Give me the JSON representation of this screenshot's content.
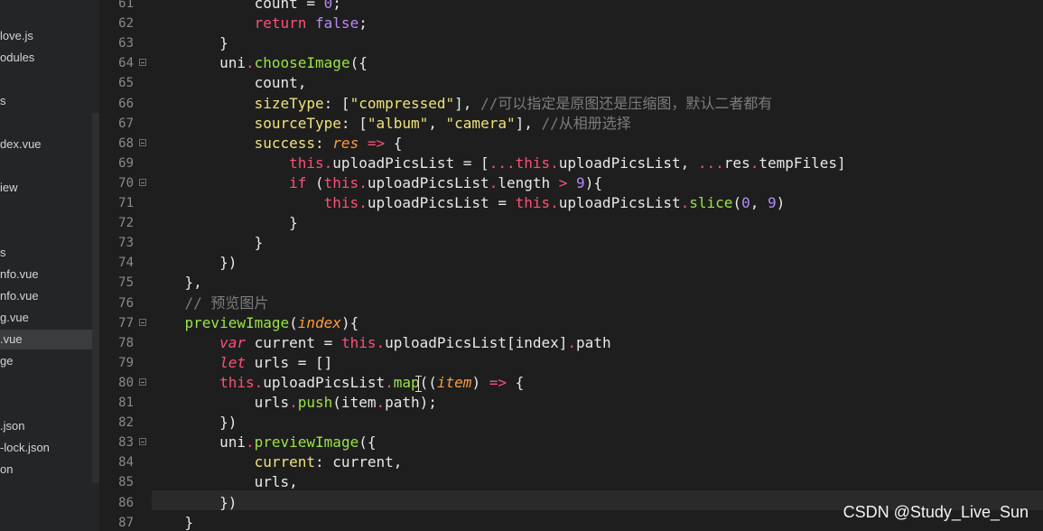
{
  "sidebar": {
    "files": [
      {
        "label": "love.js",
        "active": false
      },
      {
        "label": "odules",
        "active": false
      },
      {
        "label": "s",
        "active": false
      },
      {
        "label": "dex.vue",
        "active": false
      },
      {
        "label": "iew",
        "active": false
      },
      {
        "label": "s",
        "active": false
      },
      {
        "label": "nfo.vue",
        "active": false
      },
      {
        "label": "nfo.vue",
        "active": false
      },
      {
        "label": "g.vue",
        "active": false
      },
      {
        "label": ".vue",
        "active": true
      },
      {
        "label": "ge",
        "active": false
      },
      {
        "label": ".json",
        "active": false
      },
      {
        "label": "-lock.json",
        "active": false
      },
      {
        "label": "on",
        "active": false
      }
    ]
  },
  "editor": {
    "lines": [
      {
        "n": "61",
        "fold": false,
        "indent": "            ",
        "tokens": [
          {
            "t": "count = ",
            "c": "default"
          },
          {
            "t": "0",
            "c": "number"
          },
          {
            "t": ";",
            "c": "default"
          }
        ]
      },
      {
        "n": "62",
        "fold": false,
        "indent": "            ",
        "tokens": [
          {
            "t": "return ",
            "c": "keyword"
          },
          {
            "t": "false",
            "c": "number"
          },
          {
            "t": ";",
            "c": "default"
          }
        ]
      },
      {
        "n": "63",
        "fold": false,
        "indent": "        ",
        "tokens": [
          {
            "t": "}",
            "c": "default"
          }
        ]
      },
      {
        "n": "64",
        "fold": true,
        "indent": "        ",
        "tokens": [
          {
            "t": "uni",
            "c": "default"
          },
          {
            "t": ".",
            "c": "dot"
          },
          {
            "t": "chooseImage",
            "c": "method"
          },
          {
            "t": "({",
            "c": "default"
          }
        ]
      },
      {
        "n": "65",
        "fold": false,
        "indent": "            ",
        "tokens": [
          {
            "t": "count,",
            "c": "default"
          }
        ]
      },
      {
        "n": "66",
        "fold": false,
        "indent": "            ",
        "tokens": [
          {
            "t": "sizeType",
            "c": "string"
          },
          {
            "t": ": [",
            "c": "default"
          },
          {
            "t": "\"compressed\"",
            "c": "string"
          },
          {
            "t": "], ",
            "c": "default"
          },
          {
            "t": "//可以指定是原图还是压缩图，默认二者都有",
            "c": "comment"
          }
        ]
      },
      {
        "n": "67",
        "fold": false,
        "indent": "            ",
        "tokens": [
          {
            "t": "sourceType",
            "c": "string"
          },
          {
            "t": ": [",
            "c": "default"
          },
          {
            "t": "\"album\"",
            "c": "string"
          },
          {
            "t": ", ",
            "c": "default"
          },
          {
            "t": "\"camera\"",
            "c": "string"
          },
          {
            "t": "], ",
            "c": "default"
          },
          {
            "t": "//从相册选择",
            "c": "comment"
          }
        ]
      },
      {
        "n": "68",
        "fold": true,
        "indent": "            ",
        "tokens": [
          {
            "t": "success",
            "c": "string"
          },
          {
            "t": ": ",
            "c": "default"
          },
          {
            "t": "res",
            "c": "param"
          },
          {
            "t": " => ",
            "c": "keyword"
          },
          {
            "t": "{",
            "c": "default"
          }
        ]
      },
      {
        "n": "69",
        "fold": false,
        "indent": "                ",
        "tokens": [
          {
            "t": "this",
            "c": "keyword"
          },
          {
            "t": ".",
            "c": "dot"
          },
          {
            "t": "uploadPicsList = [",
            "c": "default"
          },
          {
            "t": "...",
            "c": "keyword"
          },
          {
            "t": "this",
            "c": "keyword"
          },
          {
            "t": ".",
            "c": "dot"
          },
          {
            "t": "uploadPicsList, ",
            "c": "default"
          },
          {
            "t": "...",
            "c": "keyword"
          },
          {
            "t": "res",
            "c": "default"
          },
          {
            "t": ".",
            "c": "dot"
          },
          {
            "t": "tempFiles]",
            "c": "default"
          }
        ]
      },
      {
        "n": "70",
        "fold": true,
        "indent": "                ",
        "tokens": [
          {
            "t": "if",
            "c": "keyword"
          },
          {
            "t": " (",
            "c": "default"
          },
          {
            "t": "this",
            "c": "keyword"
          },
          {
            "t": ".",
            "c": "dot"
          },
          {
            "t": "uploadPicsList",
            "c": "default"
          },
          {
            "t": ".",
            "c": "dot"
          },
          {
            "t": "length ",
            "c": "default"
          },
          {
            "t": ">",
            "c": "keyword"
          },
          {
            "t": " ",
            "c": "default"
          },
          {
            "t": "9",
            "c": "number"
          },
          {
            "t": "){",
            "c": "default"
          }
        ]
      },
      {
        "n": "71",
        "fold": false,
        "indent": "                    ",
        "tokens": [
          {
            "t": "this",
            "c": "keyword"
          },
          {
            "t": ".",
            "c": "dot"
          },
          {
            "t": "uploadPicsList = ",
            "c": "default"
          },
          {
            "t": "this",
            "c": "keyword"
          },
          {
            "t": ".",
            "c": "dot"
          },
          {
            "t": "uploadPicsList",
            "c": "default"
          },
          {
            "t": ".",
            "c": "dot"
          },
          {
            "t": "slice",
            "c": "method"
          },
          {
            "t": "(",
            "c": "default"
          },
          {
            "t": "0",
            "c": "number"
          },
          {
            "t": ", ",
            "c": "default"
          },
          {
            "t": "9",
            "c": "number"
          },
          {
            "t": ")",
            "c": "default"
          }
        ]
      },
      {
        "n": "72",
        "fold": false,
        "indent": "                ",
        "tokens": [
          {
            "t": "}",
            "c": "default"
          }
        ]
      },
      {
        "n": "73",
        "fold": false,
        "indent": "            ",
        "tokens": [
          {
            "t": "}",
            "c": "default"
          }
        ]
      },
      {
        "n": "74",
        "fold": false,
        "indent": "        ",
        "tokens": [
          {
            "t": "})",
            "c": "default"
          }
        ]
      },
      {
        "n": "75",
        "fold": false,
        "indent": "    ",
        "tokens": [
          {
            "t": "},",
            "c": "default"
          }
        ]
      },
      {
        "n": "76",
        "fold": false,
        "indent": "    ",
        "tokens": [
          {
            "t": "// 预览图片",
            "c": "comment"
          }
        ]
      },
      {
        "n": "77",
        "fold": true,
        "indent": "    ",
        "tokens": [
          {
            "t": "previewImage",
            "c": "method"
          },
          {
            "t": "(",
            "c": "default"
          },
          {
            "t": "index",
            "c": "param"
          },
          {
            "t": "){",
            "c": "default"
          }
        ]
      },
      {
        "n": "78",
        "fold": false,
        "indent": "        ",
        "tokens": [
          {
            "t": "var",
            "c": "var"
          },
          {
            "t": " current = ",
            "c": "default"
          },
          {
            "t": "this",
            "c": "keyword"
          },
          {
            "t": ".",
            "c": "dot"
          },
          {
            "t": "uploadPicsList[index]",
            "c": "default"
          },
          {
            "t": ".",
            "c": "dot"
          },
          {
            "t": "path",
            "c": "default"
          }
        ]
      },
      {
        "n": "79",
        "fold": false,
        "indent": "        ",
        "tokens": [
          {
            "t": "let",
            "c": "var"
          },
          {
            "t": " urls = []",
            "c": "default"
          }
        ]
      },
      {
        "n": "80",
        "fold": true,
        "indent": "        ",
        "tokens": [
          {
            "t": "this",
            "c": "keyword"
          },
          {
            "t": ".",
            "c": "dot"
          },
          {
            "t": "uploadPicsList",
            "c": "default"
          },
          {
            "t": ".",
            "c": "dot"
          },
          {
            "t": "map",
            "c": "method"
          },
          {
            "t": "((",
            "c": "default"
          },
          {
            "t": "item",
            "c": "param"
          },
          {
            "t": ") ",
            "c": "default"
          },
          {
            "t": "=>",
            "c": "keyword"
          },
          {
            "t": " {",
            "c": "default"
          }
        ]
      },
      {
        "n": "81",
        "fold": false,
        "indent": "            ",
        "tokens": [
          {
            "t": "urls",
            "c": "default"
          },
          {
            "t": ".",
            "c": "dot"
          },
          {
            "t": "push",
            "c": "method"
          },
          {
            "t": "(item",
            "c": "default"
          },
          {
            "t": ".",
            "c": "dot"
          },
          {
            "t": "path);",
            "c": "default"
          }
        ]
      },
      {
        "n": "82",
        "fold": false,
        "indent": "        ",
        "tokens": [
          {
            "t": "})",
            "c": "default"
          }
        ]
      },
      {
        "n": "83",
        "fold": true,
        "indent": "        ",
        "tokens": [
          {
            "t": "uni",
            "c": "default"
          },
          {
            "t": ".",
            "c": "dot"
          },
          {
            "t": "previewImage",
            "c": "method"
          },
          {
            "t": "({",
            "c": "default"
          }
        ]
      },
      {
        "n": "84",
        "fold": false,
        "indent": "            ",
        "tokens": [
          {
            "t": "current",
            "c": "string"
          },
          {
            "t": ": current,",
            "c": "default"
          }
        ]
      },
      {
        "n": "85",
        "fold": false,
        "indent": "            ",
        "tokens": [
          {
            "t": "urls,",
            "c": "default"
          }
        ]
      },
      {
        "n": "86",
        "fold": false,
        "indent": "        ",
        "tokens": [
          {
            "t": "})",
            "c": "default"
          }
        ]
      },
      {
        "n": "87",
        "fold": false,
        "indent": "    ",
        "tokens": [
          {
            "t": "}",
            "c": "default"
          }
        ]
      }
    ]
  },
  "watermark": "CSDN @Study_Live_Sun"
}
